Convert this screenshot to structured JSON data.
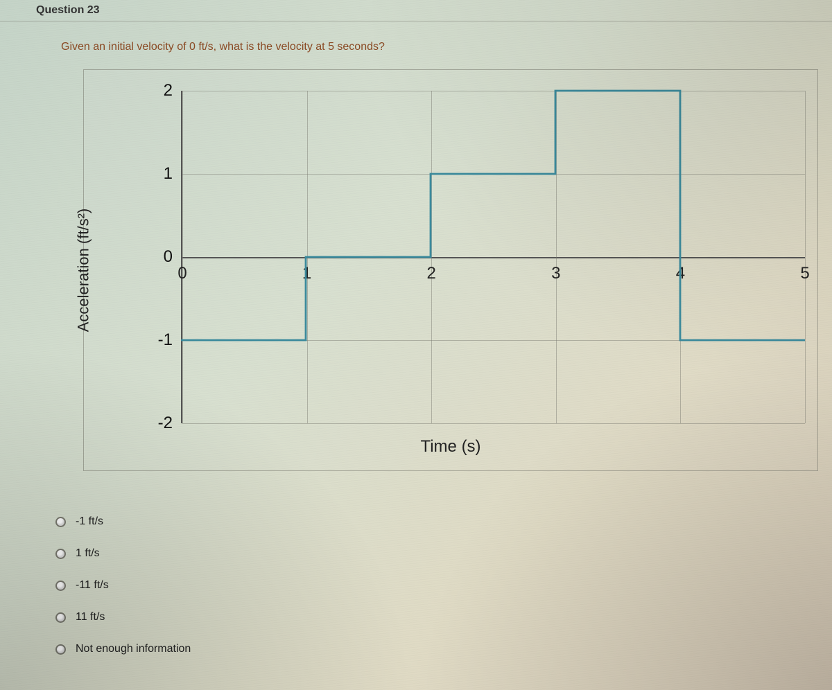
{
  "question": {
    "number_label": "Question 23",
    "prompt": "Given an initial velocity of 0 ft/s, what is the velocity at 5 seconds?"
  },
  "chart_data": {
    "type": "line",
    "step_mode": "hv",
    "xlabel": "Time (s)",
    "ylabel": "Acceleration (ft/s²)",
    "xlim": [
      0,
      5
    ],
    "ylim": [
      -2,
      2
    ],
    "x_ticks": [
      0,
      1,
      2,
      3,
      4,
      5
    ],
    "y_ticks": [
      -2,
      -1,
      0,
      1,
      2
    ],
    "series": [
      {
        "name": "acceleration",
        "segments": [
          {
            "t_start": 0,
            "t_end": 1,
            "value": -1
          },
          {
            "t_start": 1,
            "t_end": 2,
            "value": 0
          },
          {
            "t_start": 2,
            "t_end": 3,
            "value": 1
          },
          {
            "t_start": 3,
            "t_end": 4,
            "value": 2
          },
          {
            "t_start": 4,
            "t_end": 5,
            "value": -1
          }
        ]
      }
    ]
  },
  "answers": {
    "options": [
      {
        "label": "-1 ft/s"
      },
      {
        "label": "1 ft/s"
      },
      {
        "label": "-11 ft/s"
      },
      {
        "label": "11 ft/s"
      },
      {
        "label": "Not enough information"
      }
    ]
  }
}
